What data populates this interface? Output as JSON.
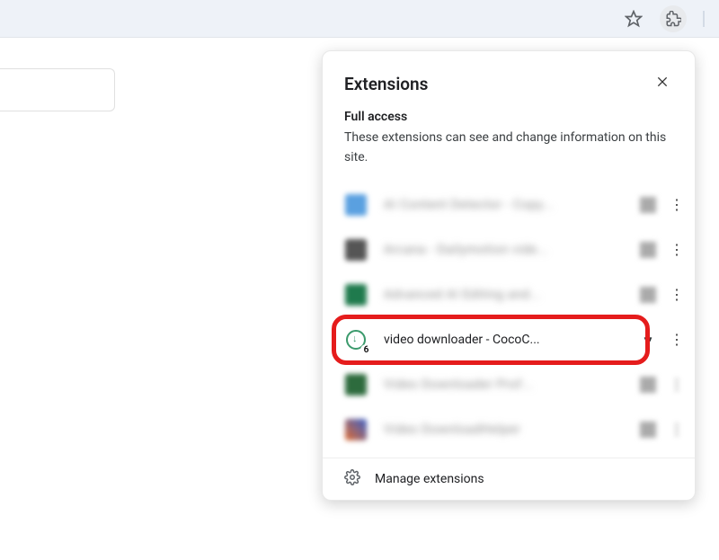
{
  "toolbar": {
    "star_title": "Bookmark this tab",
    "ext_title": "Extensions"
  },
  "popup": {
    "title": "Extensions",
    "close_label": "Close",
    "section_title": "Full access",
    "section_desc": "These extensions can see and change information on this site.",
    "footer": "Manage extensions"
  },
  "extensions": [
    {
      "name": "AI Content Detector - Copy...",
      "blurred": true,
      "badge": ""
    },
    {
      "name": "Arcana - Dailymotion vide...",
      "blurred": true,
      "badge": ""
    },
    {
      "name": "Advanced AI Editing and...",
      "blurred": true,
      "badge": ""
    },
    {
      "name": "video downloader - CocoC...",
      "blurred": false,
      "badge": "6",
      "highlighted": true
    },
    {
      "name": "Video Downloader Prof...",
      "blurred": true,
      "badge": ""
    },
    {
      "name": "Video DownloadHelper",
      "blurred": true,
      "badge": ""
    }
  ]
}
